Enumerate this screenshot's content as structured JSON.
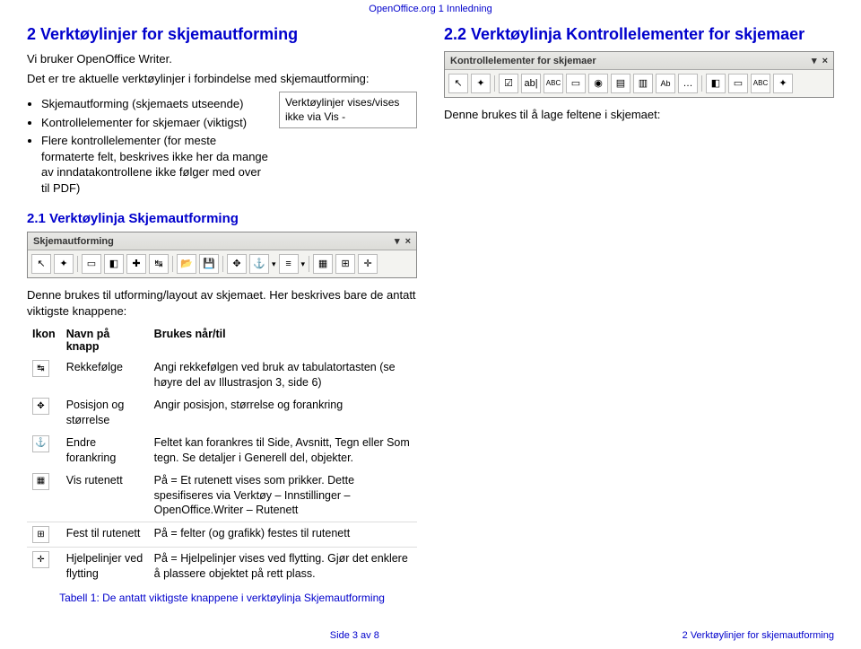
{
  "header": {
    "text": "OpenOffice.org 1 Innledning"
  },
  "left": {
    "h1": "2   Verktøylinjer for skjemautforming",
    "intro": "Vi bruker OpenOffice Writer.",
    "p2": "Det er tre aktuelle verktøylinjer i forbindelse med skjemautforming:",
    "bullets": {
      "b1": "Skjemautforming (skjemaets utseende)",
      "b2": "Kontrollelementer for skjemaer (viktigst)",
      "b3": "Flere kontrollelementer (for meste formaterte felt, beskrives ikke her da mange av inndatakontrollene ikke følger med over til PDF)"
    },
    "notebox": "Verktøylinjer vises/vises ikke via Vis -",
    "h2": "2.1   Verktøylinja Skjemautforming",
    "toolbar1_title": "Skjemautforming",
    "desc_p": "Denne brukes til utforming/layout av skjemaet. Her beskrives bare de antatt viktigste knappene:",
    "tbl": {
      "h_icon": "Ikon",
      "h_name": "Navn på knapp",
      "h_use": "Brukes når/til",
      "rows": [
        {
          "name": "Rekkefølge",
          "use": "Angi rekkefølgen ved bruk av tabulatortasten (se høyre del av Illustrasjon 3, side 6)"
        },
        {
          "name": "Posisjon og størrelse",
          "use": "Angir posisjon, størrelse og forankring"
        },
        {
          "name": "Endre forankring",
          "use": "Feltet kan forankres til Side, Avsnitt, Tegn eller Som tegn. Se detaljer i Generell del, objekter."
        },
        {
          "name": "Vis rutenett",
          "use": "På = Et rutenett vises som prikker. Dette spesifiseres via Verktøy – Innstillinger – OpenOffice.Writer – Rutenett"
        },
        {
          "name": "Fest til rutenett",
          "use": "På = felter (og grafikk) festes til rutenett"
        },
        {
          "name": "Hjelpelinjer ved flytting",
          "use": "På = Hjelpelinjer vises ved flytting. Gjør det enklere å plassere objektet på rett plass."
        }
      ]
    },
    "caption": "Tabell 1:  De antatt viktigste knappene i verktøylinja Skjemautforming"
  },
  "right": {
    "h1": "2.2   Verktøylinja Kontrollelementer for skjemaer",
    "toolbar2_title": "Kontrollelementer for skjemaer",
    "p1": "Denne brukes til å lage feltene i skjemaet:"
  },
  "footer": {
    "mid": "Side 3 av 8",
    "right": "2 Verktøylinjer for skjemautforming"
  },
  "icons": {
    "dropdown": "▾",
    "close": "×",
    "cursor": "↖",
    "wizard": "✦",
    "form": "▭",
    "nav": "◧",
    "addfield": "✚",
    "order": "↹",
    "open": "📂",
    "save": "💾",
    "anchor": "⚓",
    "align": "≡",
    "grid": "▦",
    "snap": "⊞",
    "guides": "✛",
    "checkbox": "☑",
    "text": "ab|",
    "abc": "ABC",
    "radio": "◉",
    "list": "▤",
    "combo": "▥",
    "label": "Ab",
    "more": "…",
    "pos": "✥",
    "rekke_icon": "↹",
    "pos_icon": "✥",
    "anchor_icon": "⚓",
    "grid_icon": "▦",
    "snap_icon": "⊞",
    "guides_icon": "✛"
  }
}
